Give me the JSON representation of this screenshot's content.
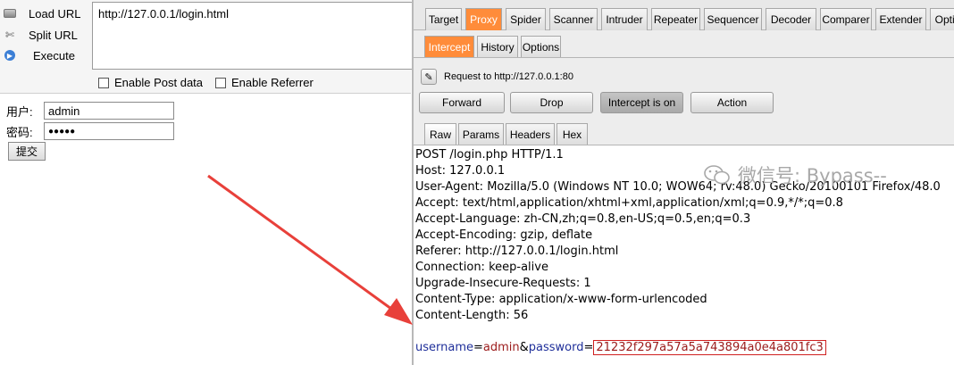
{
  "hackbar": {
    "load_url": "Load URL",
    "split_url": "Split URL",
    "execute": "Execute",
    "url_value": "http://127.0.0.1/login.html",
    "enable_post": "Enable Post data",
    "enable_referrer": "Enable Referrer"
  },
  "login_form": {
    "user_label": "用户:",
    "user_value": "admin",
    "pass_label": "密码:",
    "pass_masked": "●●●●●",
    "submit": "提交"
  },
  "burp": {
    "main_tabs": [
      "Target",
      "Proxy",
      "Spider",
      "Scanner",
      "Intruder",
      "Repeater",
      "Sequencer",
      "Decoder",
      "Comparer",
      "Extender",
      "Optio"
    ],
    "active_main_tab": "Proxy",
    "sub_tabs": [
      "Intercept",
      "History",
      "Options"
    ],
    "active_sub_tab": "Intercept",
    "request_to": "Request to http://127.0.0.1:80",
    "buttons": {
      "forward": "Forward",
      "drop": "Drop",
      "intercept": "Intercept is on",
      "action": "Action"
    },
    "editor_tabs": [
      "Raw",
      "Params",
      "Headers",
      "Hex"
    ],
    "active_editor_tab": "Raw",
    "request_lines": [
      "POST /login.php HTTP/1.1",
      "Host: 127.0.0.1",
      "User-Agent: Mozilla/5.0 (Windows NT 10.0; WOW64; rv:48.0) Gecko/20100101 Firefox/48.0",
      "Accept: text/html,application/xhtml+xml,application/xml;q=0.9,*/*;q=0.8",
      "Accept-Language: zh-CN,zh;q=0.8,en-US;q=0.5,en;q=0.3",
      "Accept-Encoding: gzip, deflate",
      "Referer: http://127.0.0.1/login.html",
      "Connection: keep-alive",
      "Upgrade-Insecure-Requests: 1",
      "Content-Type: application/x-www-form-urlencoded",
      "Content-Length: 56"
    ],
    "body": {
      "key1": "username",
      "eq1": "=",
      "val1": "admin",
      "amp": "&",
      "key2": "password",
      "eq2": "=",
      "val2": "21232f297a57a5a743894a0e4a801fc3"
    },
    "watermark": "微信号: Bypass--"
  },
  "colors": {
    "accent_tab": "#ff8c3a",
    "arrow": "#e8403a",
    "highlight_box": "#d02020"
  }
}
